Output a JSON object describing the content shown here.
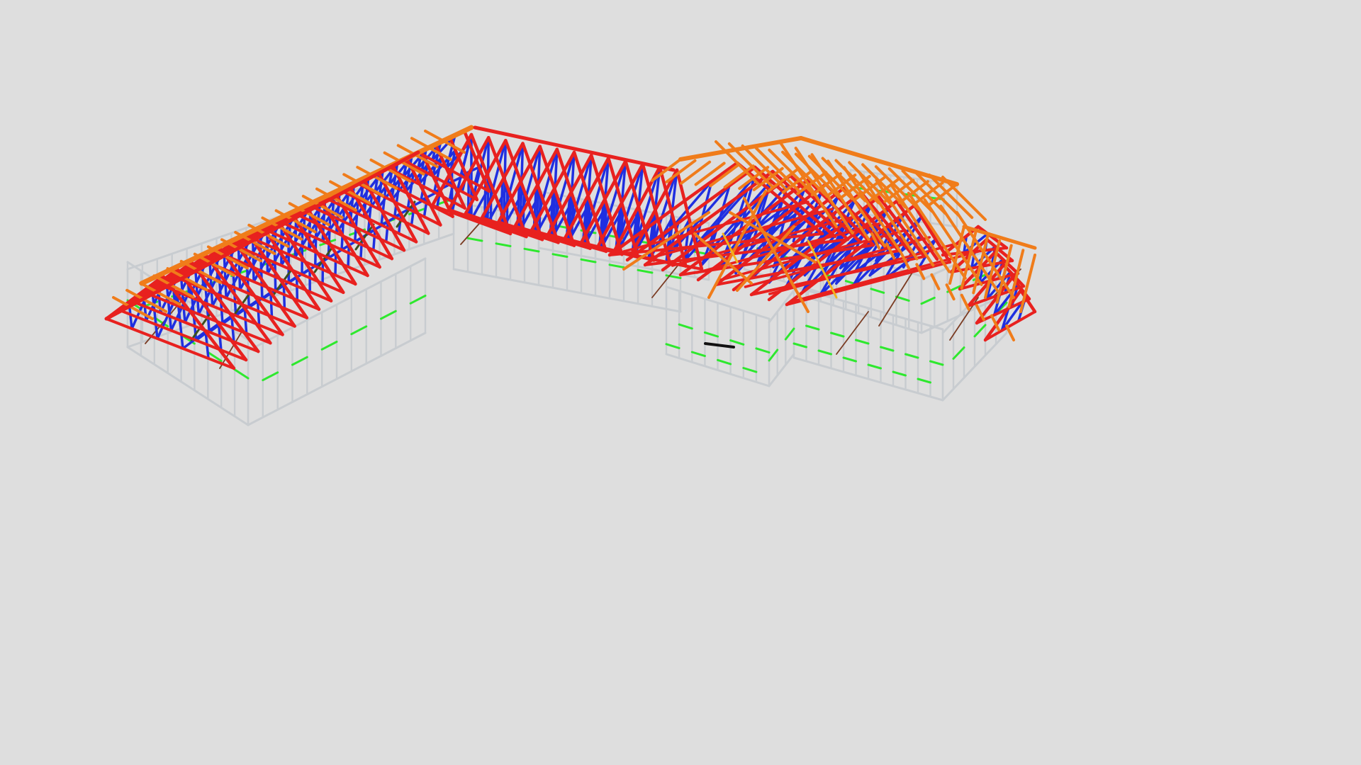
{
  "viewer": {
    "background_color": "#dedede"
  },
  "model": {
    "description_visible_text": "",
    "member_colors": {
      "top_chord": "#f07c1a",
      "rafter_red": "#e8211f",
      "web_blue": "#1f2fe0",
      "wall_frame": "#c8ccd0",
      "noggin_green": "#2ee82e",
      "brace_brown": "#7a3b22",
      "dark_member": "#3b5020",
      "black_member": "#111111",
      "yellow_member": "#f2b21c"
    }
  }
}
